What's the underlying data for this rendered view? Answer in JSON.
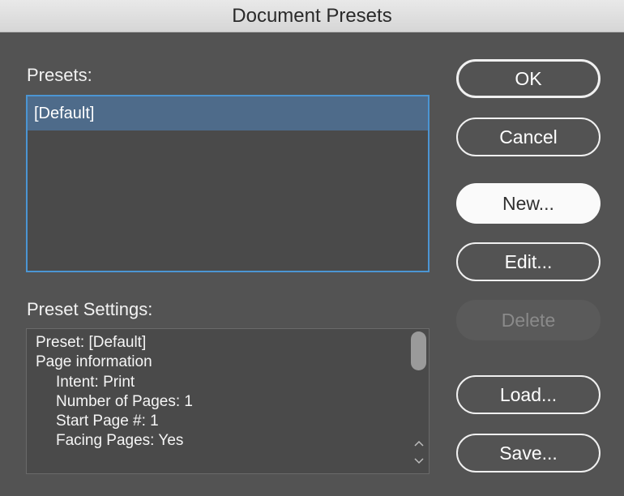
{
  "window": {
    "title": "Document Presets"
  },
  "presets": {
    "label": "Presets:",
    "items": [
      {
        "label": "[Default]",
        "selected": true
      }
    ]
  },
  "settings": {
    "label": "Preset Settings:",
    "lines": [
      {
        "text": "Preset: [Default]",
        "indent": 0
      },
      {
        "text": "Page information",
        "indent": 0
      },
      {
        "text": "Intent: Print",
        "indent": 1
      },
      {
        "text": "Number of Pages: 1",
        "indent": 1
      },
      {
        "text": "Start Page #: 1",
        "indent": 1
      },
      {
        "text": "Facing Pages: Yes",
        "indent": 1
      }
    ]
  },
  "buttons": {
    "ok": "OK",
    "cancel": "Cancel",
    "new": "New...",
    "edit": "Edit...",
    "delete": "Delete",
    "load": "Load...",
    "save": "Save..."
  },
  "icons": {
    "scroll_up": "chevron-up-icon",
    "scroll_down": "chevron-down-icon"
  },
  "colors": {
    "background": "#535353",
    "selection": "#4e6b8a",
    "focus_ring": "#4b95d3"
  }
}
